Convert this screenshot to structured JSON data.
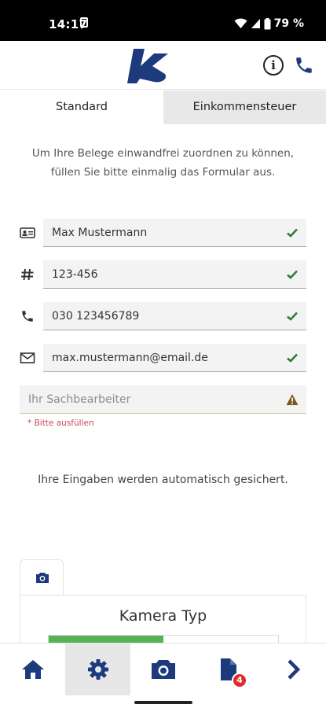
{
  "status_bar": {
    "time": "14:17",
    "battery": "79 %"
  },
  "header": {
    "logo_text": "bkb",
    "info_icon": "info-icon",
    "phone_icon": "phone-icon"
  },
  "tabs": [
    {
      "label": "Standard",
      "active": true
    },
    {
      "label": "Einkommensteuer",
      "active": false
    }
  ],
  "intro_text": "Um Ihre Belege einwandfrei zuordnen zu können, füllen Sie bitte einmalig das Formular aus.",
  "form": {
    "name": {
      "value": "Max Mustermann",
      "icon": "id-card-icon",
      "status": "valid"
    },
    "number": {
      "value": "123-456",
      "icon": "hash-icon",
      "status": "valid"
    },
    "phone": {
      "value": "030 123456789",
      "icon": "phone-icon",
      "status": "valid"
    },
    "email": {
      "value": "max.mustermann@email.de",
      "icon": "mail-icon",
      "status": "valid"
    },
    "sachbearbeiter": {
      "value": "",
      "placeholder": "Ihr Sachbearbeiter",
      "status": "warning",
      "error": "* Bitte ausfüllen"
    }
  },
  "autosave_text": "Ihre Eingaben werden automatisch gesichert.",
  "camera_card": {
    "title": "Kamera Typ",
    "progress": 0.5
  },
  "bottom_nav": {
    "items": [
      "home",
      "settings",
      "camera",
      "documents",
      "next"
    ],
    "active": "settings",
    "documents_badge": "4"
  },
  "colors": {
    "brand_blue": "#1d3a7c",
    "valid_green": "#2e7d32",
    "warning": "#7a5a1a",
    "error_red": "#c74a60",
    "progress_green": "#57b257"
  }
}
